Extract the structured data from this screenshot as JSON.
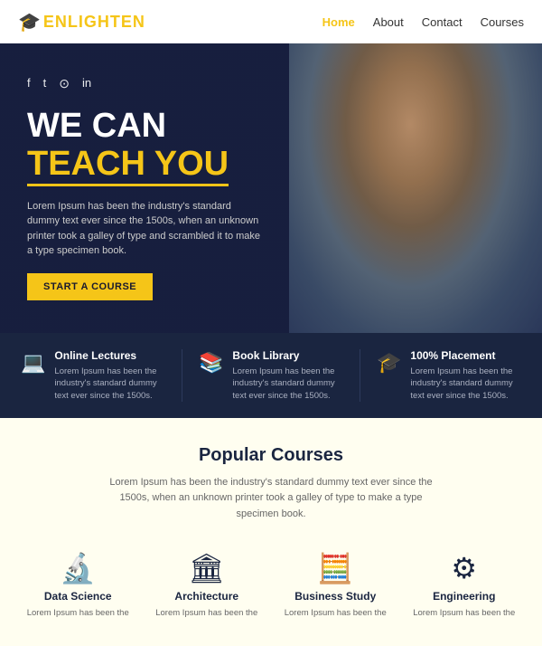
{
  "brand": {
    "name": "ENLIGHTEN",
    "hat_icon": "🎓"
  },
  "navbar": {
    "links": [
      {
        "label": "Home",
        "active": true
      },
      {
        "label": "About",
        "active": false
      },
      {
        "label": "Contact",
        "active": false
      },
      {
        "label": "Courses",
        "active": false
      }
    ]
  },
  "social": {
    "icons": [
      "f",
      "t",
      "in-icon",
      "li"
    ]
  },
  "hero": {
    "line1": "WE CAN",
    "line2": "TEACH YOU",
    "description": "Lorem Ipsum has been the industry's standard dummy text ever since the 1500s, when an unknown printer took a galley of type and scrambled it to make a type specimen book.",
    "button_label": "START A COURSE"
  },
  "features": [
    {
      "icon": "💻",
      "title": "Online Lectures",
      "desc": "Lorem Ipsum has been the industry's standard dummy text ever since the 1500s."
    },
    {
      "icon": "📚",
      "title": "Book Library",
      "desc": "Lorem Ipsum has been the industry's standard dummy text ever since the 1500s."
    },
    {
      "icon": "🎓",
      "title": "100% Placement",
      "desc": "Lorem Ipsum has been the industry's standard dummy text ever since the 1500s."
    }
  ],
  "popular": {
    "title": "Popular Courses",
    "description": "Lorem Ipsum has been the industry's standard dummy text ever since the 1500s, when an unknown printer took a galley of type to make a type specimen book.",
    "courses": [
      {
        "icon": "🔬",
        "title": "Data Science",
        "desc": "Lorem Ipsum has been the"
      },
      {
        "icon": "🏛",
        "title": "Architecture",
        "desc": "Lorem Ipsum has been the"
      },
      {
        "icon": "🧮",
        "title": "Business Study",
        "desc": "Lorem Ipsum has been the"
      },
      {
        "icon": "⚙",
        "title": "Engineering",
        "desc": "Lorem Ipsum has been the"
      }
    ]
  }
}
